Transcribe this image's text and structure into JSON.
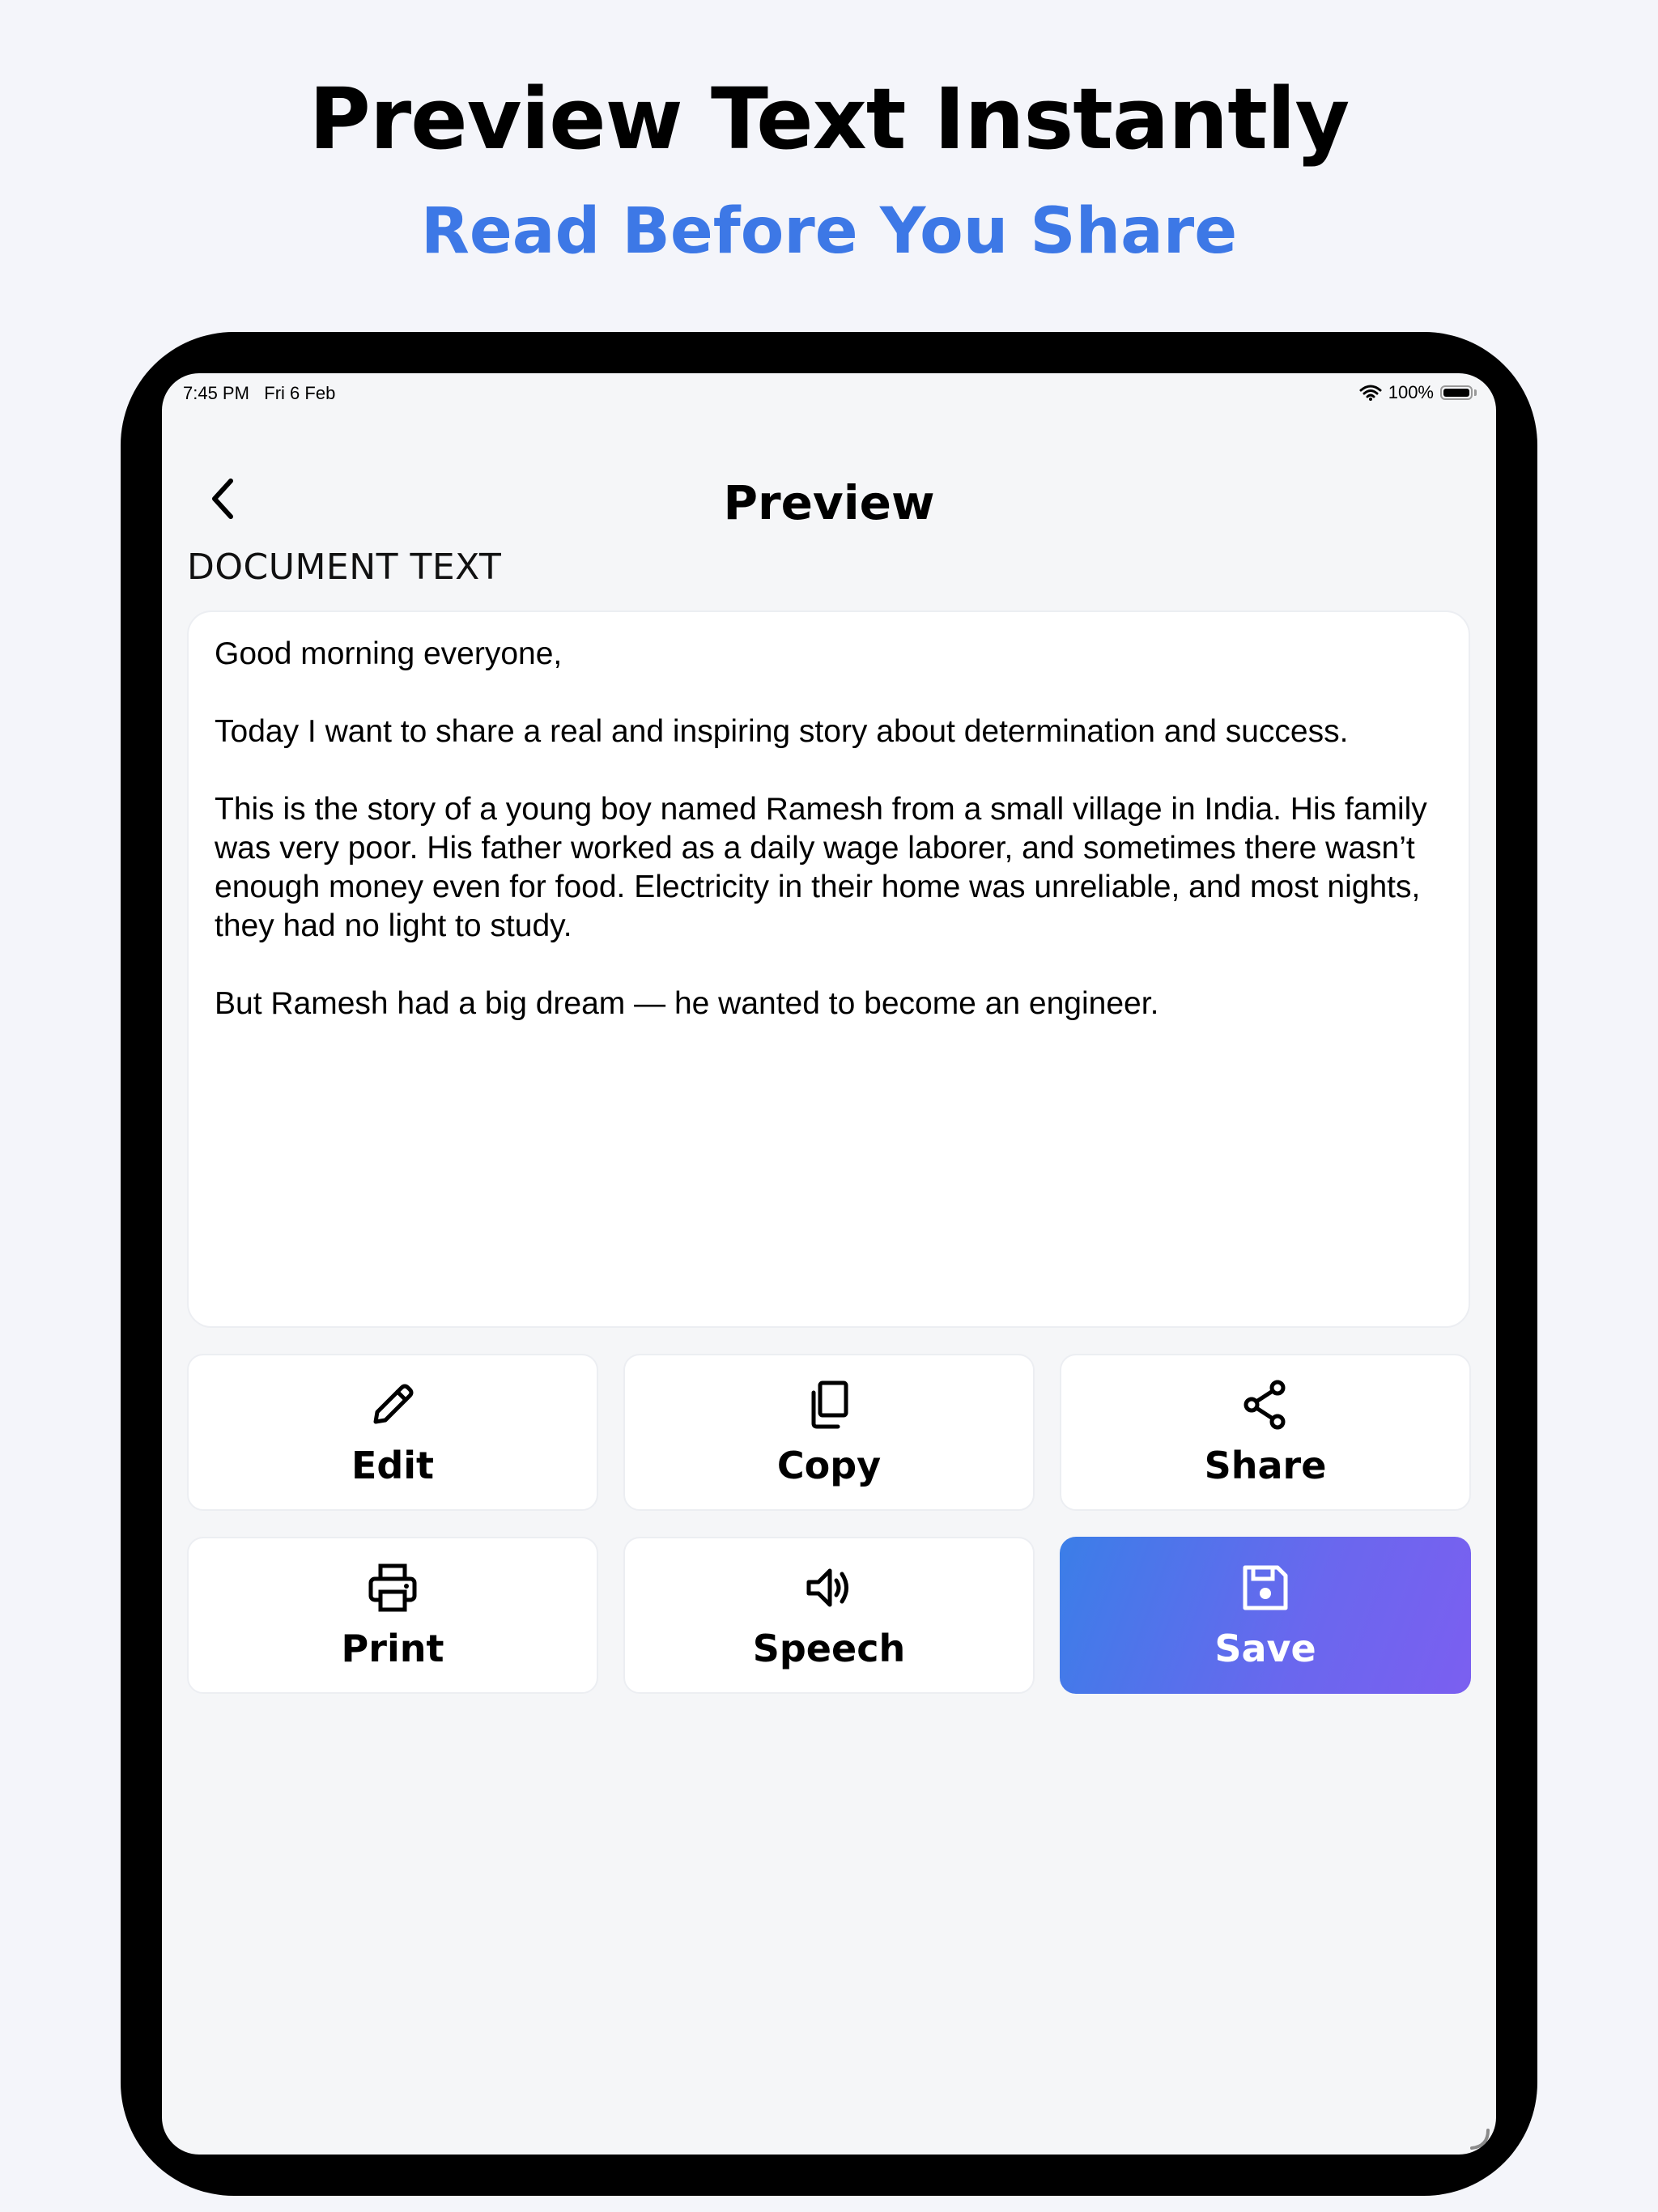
{
  "marketing": {
    "headline": "Preview Text Instantly",
    "subheadline": "Read Before You Share"
  },
  "status_bar": {
    "time": "7:45 PM",
    "date": "Fri 6 Feb",
    "battery": "100%",
    "battery_level": 1.0
  },
  "nav": {
    "title": "Preview"
  },
  "section_label": "DOCUMENT TEXT",
  "document": {
    "paragraphs": [
      "Good morning everyone,",
      "Today I want to share a real and inspiring story about determination and success.",
      "This is the story of a young boy named Ramesh from a small village in India. His family was very poor. His father worked as a daily wage laborer, and sometimes there wasn’t enough money even for food. Electricity in their home was unreliable, and most nights, they had no light to study.",
      "But Ramesh had a big dream — he wanted to become an engineer."
    ]
  },
  "actions": [
    {
      "label": "Edit",
      "icon": "pencil-icon"
    },
    {
      "label": "Copy",
      "icon": "copy-icon"
    },
    {
      "label": "Share",
      "icon": "share-icon"
    },
    {
      "label": "Print",
      "icon": "printer-icon"
    },
    {
      "label": "Speech",
      "icon": "speaker-icon"
    },
    {
      "label": "Save",
      "icon": "floppy-disk-icon"
    }
  ],
  "colors": {
    "accent": "#3d78e6",
    "save_gradient_start": "#3b7ee8",
    "save_gradient_end": "#7b5ff0",
    "background": "#f4f5fa"
  }
}
